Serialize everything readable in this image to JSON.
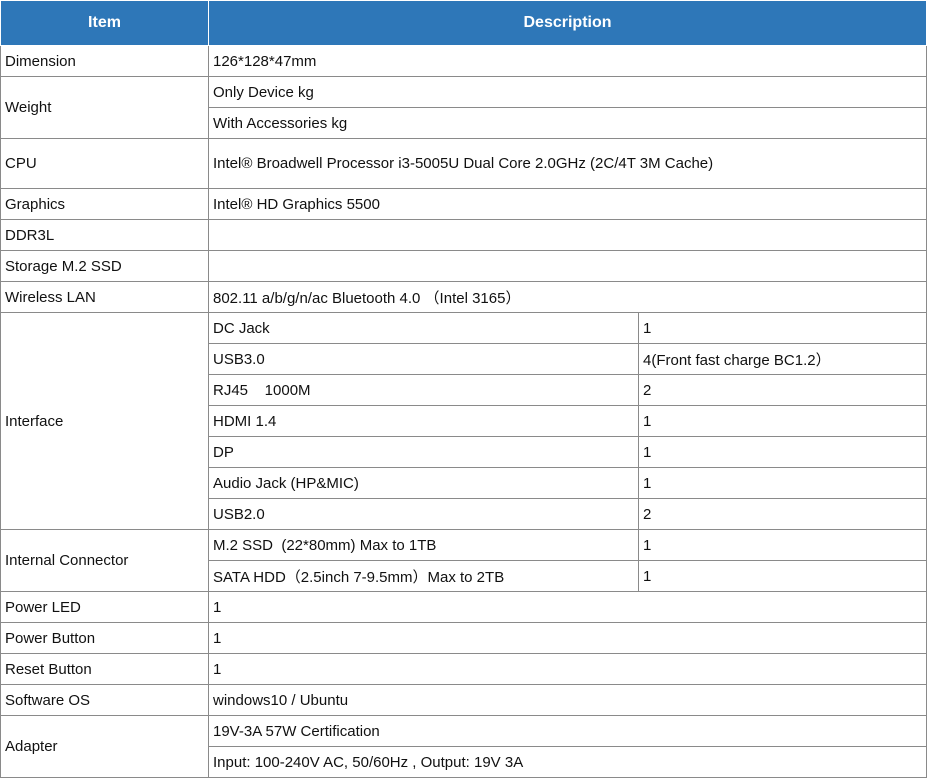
{
  "header": {
    "item": "Item",
    "description": "Description"
  },
  "rows": {
    "dimension": {
      "label": "Dimension",
      "value": "126*128*47mm"
    },
    "weight": {
      "label": "Weight",
      "device": "Only Device kg",
      "accessories": "With Accessories kg"
    },
    "cpu": {
      "label": "CPU",
      "value": "Intel® Broadwell Processor i3-5005U Dual Core 2.0GHz (2C/4T 3M Cache)"
    },
    "graphics": {
      "label": "Graphics",
      "value": "Intel® HD Graphics 5500"
    },
    "ddr3l": {
      "label": "DDR3L",
      "value": ""
    },
    "storage": {
      "label": "Storage M.2 SSD",
      "value": ""
    },
    "wireless": {
      "label": "Wireless LAN",
      "value": "802.11 a/b/g/n/ac  Bluetooth 4.0 （Intel 3165）"
    },
    "interface": {
      "label": "Interface",
      "items": [
        {
          "name": "DC Jack",
          "qty": "1"
        },
        {
          "name": "USB3.0",
          "qty": "4(Front fast charge BC1.2）"
        },
        {
          "name": "RJ45    1000M",
          "qty": "2"
        },
        {
          "name": "HDMI 1.4",
          "qty": "1"
        },
        {
          "name": "DP",
          "qty": "1"
        },
        {
          "name": "Audio Jack (HP&MIC)",
          "qty": "1"
        },
        {
          "name": "USB2.0",
          "qty": "2"
        }
      ]
    },
    "internal_connector": {
      "label": "Internal Connector",
      "items": [
        {
          "name": "M.2 SSD  (22*80mm) Max to 1TB",
          "qty": "1"
        },
        {
          "name": "SATA HDD（2.5inch 7-9.5mm）Max to 2TB",
          "qty": "1"
        }
      ]
    },
    "power_led": {
      "label": "Power LED",
      "value": "1"
    },
    "power_button": {
      "label": "Power Button",
      "value": "1"
    },
    "reset_button": {
      "label": "Reset Button",
      "value": "1"
    },
    "software_os": {
      "label": "Software OS",
      "value": "windows10 / Ubuntu"
    },
    "adapter": {
      "label": "Adapter",
      "certification": "19V-3A 57W Certification",
      "io": "Input: 100-240V AC, 50/60Hz , Output: 19V 3A"
    }
  }
}
